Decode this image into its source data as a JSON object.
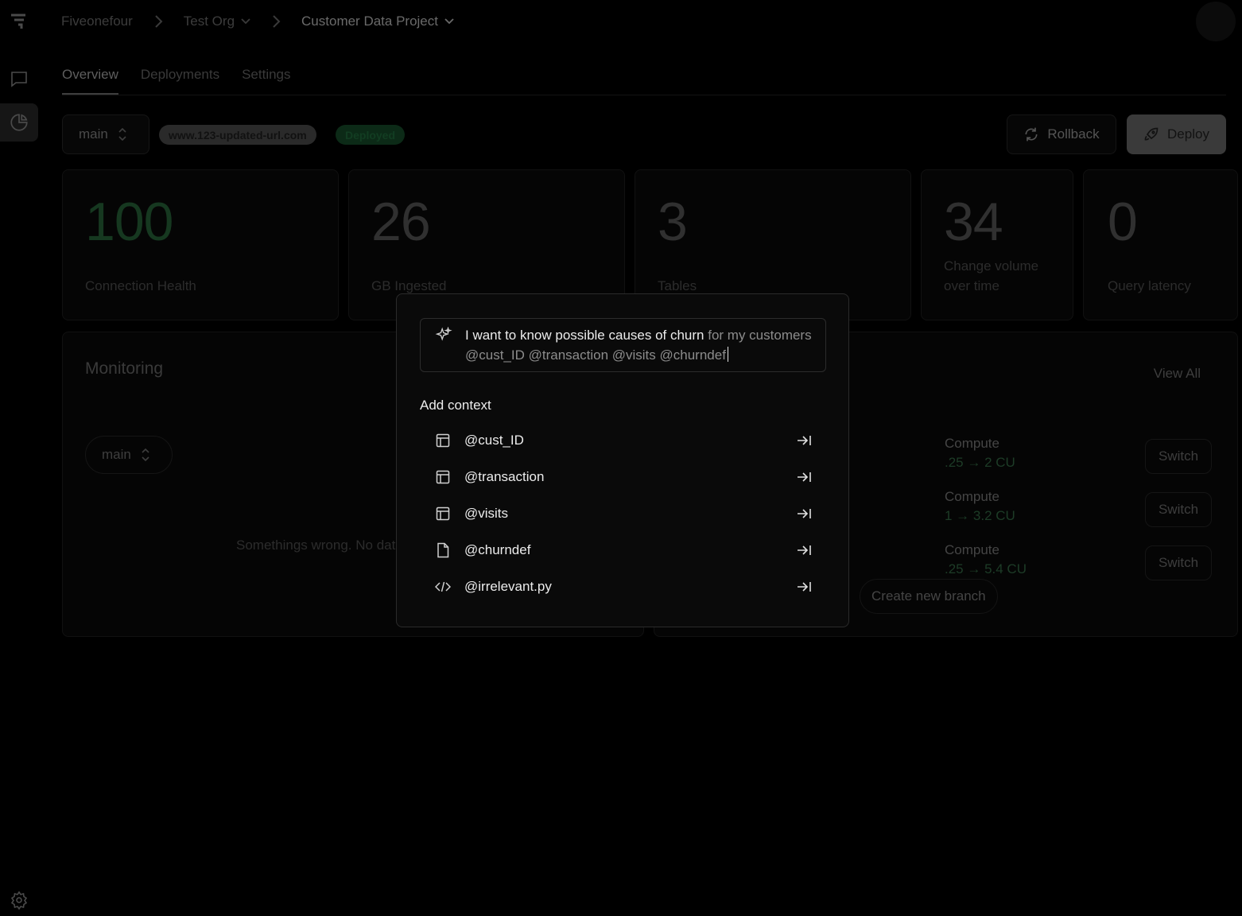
{
  "breadcrumb": {
    "org_root": "Fiveonefour",
    "org": "Test Org",
    "project": "Customer Data Project"
  },
  "tabs": [
    "Overview",
    "Deployments",
    "Settings"
  ],
  "toolbar": {
    "branch": "main",
    "url": "www.123-updated-url.com",
    "status": "Deployed",
    "rollback_label": "Rollback",
    "deploy_label": "Deploy"
  },
  "stats": [
    {
      "value": "100",
      "label": "Connection Health"
    },
    {
      "value": "26",
      "label": "GB Ingested"
    },
    {
      "value": "3",
      "label": "Tables"
    },
    {
      "value": "34",
      "label": "Change volume over time"
    },
    {
      "value": "0",
      "label": "Query latency"
    }
  ],
  "monitoring": {
    "title": "Monitoring",
    "branch": "main",
    "empty_message": "Somethings wrong. No dat",
    "view_all": "View All",
    "compute_rows": [
      {
        "title": "Compute",
        "value": ".25 → 2 CU",
        "action": "Switch"
      },
      {
        "title": "Compute",
        "value": "1 → 3.2 CU",
        "action": "Switch"
      },
      {
        "title": "Compute",
        "value": ".25 → 5.4 CU",
        "action": "Switch"
      }
    ],
    "create_branch": "Create new branch"
  },
  "modal": {
    "prompt_strong": "I want to know possible causes of churn",
    "prompt_rest": "for my customers @cust_ID @transaction @visits @churndef",
    "context_title": "Add context",
    "context_items": [
      {
        "icon": "table-icon",
        "label": "@cust_ID"
      },
      {
        "icon": "table-icon",
        "label": "@transaction"
      },
      {
        "icon": "table-icon",
        "label": "@visits"
      },
      {
        "icon": "file-icon",
        "label": "@churndef"
      },
      {
        "icon": "code-icon",
        "label": "@irrelevant.py"
      }
    ]
  },
  "colors": {
    "accent_green": "#163820",
    "modal_text": "#ececec",
    "background": "#000000"
  }
}
